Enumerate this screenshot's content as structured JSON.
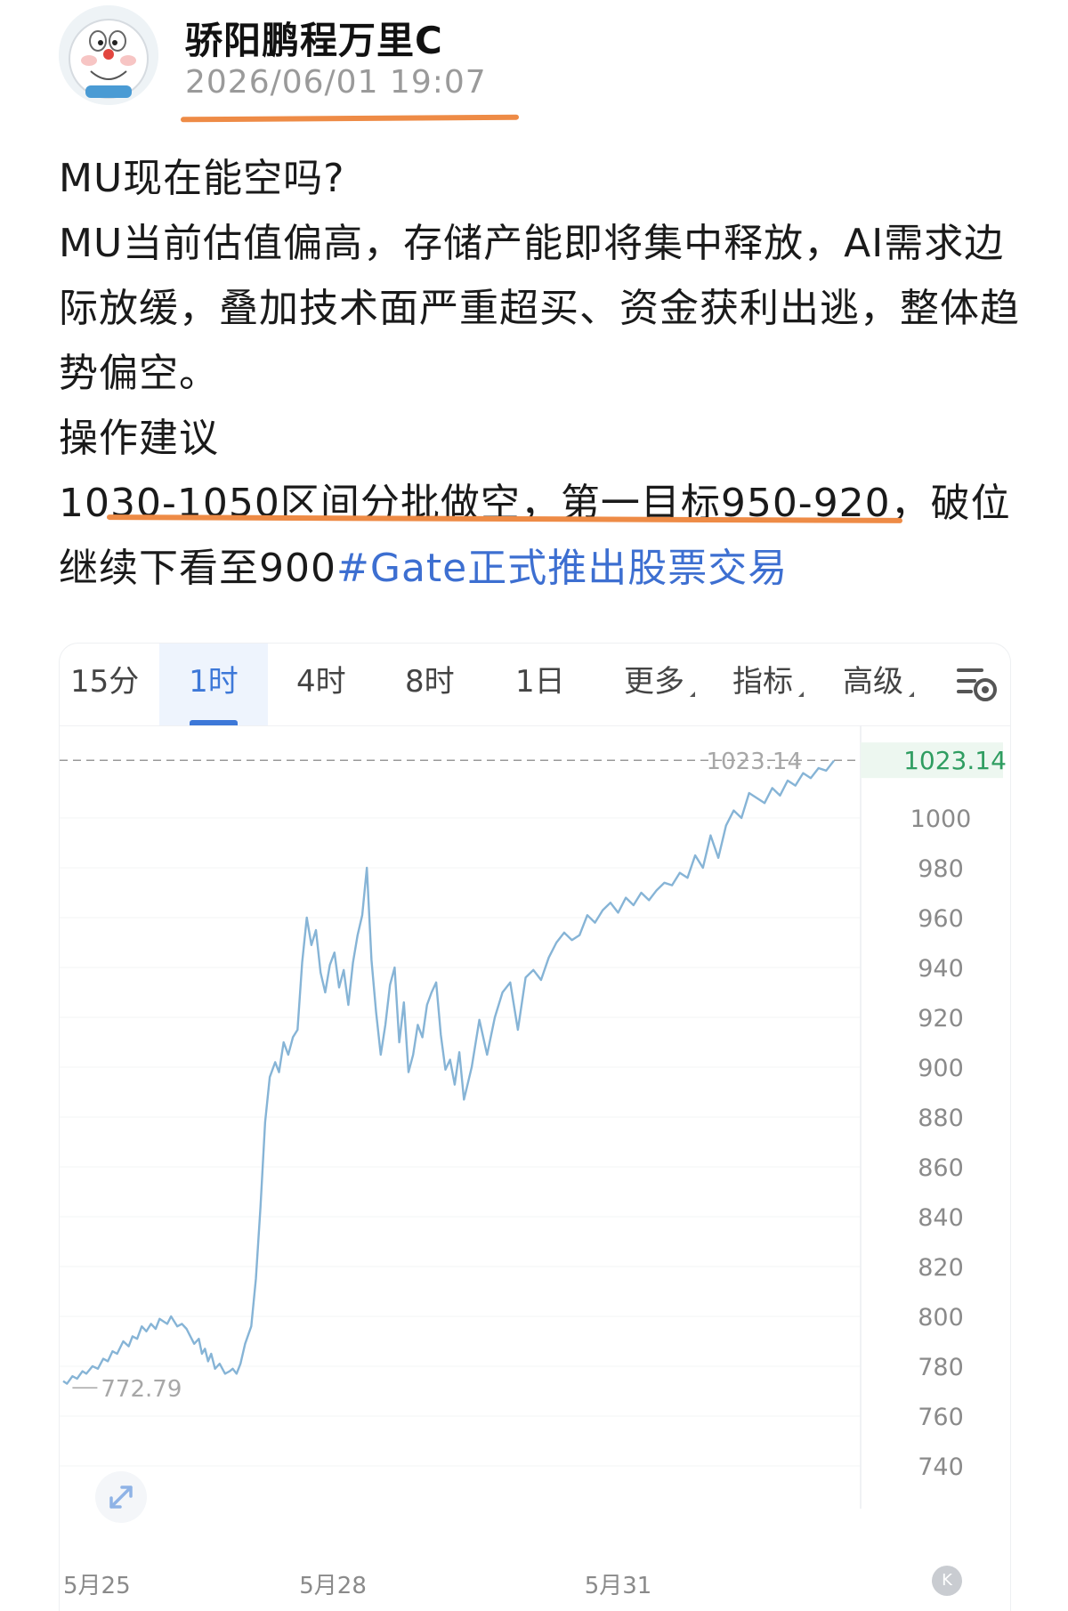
{
  "post": {
    "author": "骄阳鹏程万里C",
    "timestamp": "2026/06/01 19:07",
    "lines": [
      "MU现在能空吗?",
      "MU当前估值偏高，存储产能即将集中释放，AI需求边际放缓，叠加技术面严重超买、资金获利出逃，整体趋势偏空。",
      "操作建议",
      "1030-1050区间分批做空，第一目标950-920，破位继续下看至900"
    ],
    "hashtag": "#Gate正式推出股票交易"
  },
  "chart_toolbar": {
    "tabs": [
      {
        "label": "15分"
      },
      {
        "label": "1时"
      },
      {
        "label": "4时"
      },
      {
        "label": "8时"
      },
      {
        "label": "1日"
      },
      {
        "label": "更多"
      },
      {
        "label": "指标"
      },
      {
        "label": "高级"
      }
    ],
    "active_tab": "1时",
    "settings_icon": "chart-settings-icon"
  },
  "colors": {
    "accent": "#3d78d8",
    "line": "#86b4d6",
    "current_price": "#2f9d61",
    "highlight_underline": "#ee8b46",
    "hashtag": "#3d6fd1"
  },
  "chart_data": {
    "type": "line",
    "current_price": "1023.14",
    "high_label": "1023.14",
    "low_label": "772.79",
    "ylim": [
      730,
      1030
    ],
    "yticks": [
      1000,
      980,
      960,
      940,
      920,
      900,
      880,
      860,
      840,
      820,
      800,
      780,
      760,
      740
    ],
    "xticks": [
      "5月25",
      "5月28",
      "5月31"
    ],
    "x_range": [
      0,
      1.0
    ],
    "xtick_positions": [
      0.0,
      0.35,
      0.72
    ],
    "series": [
      {
        "x": [
          0.0,
          0.005,
          0.012,
          0.018,
          0.025,
          0.03,
          0.038,
          0.045,
          0.052,
          0.058,
          0.064,
          0.07,
          0.078,
          0.085,
          0.09,
          0.096,
          0.102,
          0.108,
          0.114,
          0.12,
          0.125,
          0.13,
          0.135,
          0.14,
          0.148,
          0.154,
          0.16,
          0.165,
          0.17,
          0.176,
          0.18,
          0.184,
          0.188,
          0.192,
          0.197,
          0.203,
          0.21,
          0.216,
          0.22,
          0.225,
          0.23,
          0.236,
          0.244,
          0.25,
          0.256,
          0.262,
          0.268,
          0.275,
          0.28,
          0.286,
          0.292,
          0.298,
          0.304,
          0.31,
          0.316,
          0.322,
          0.328,
          0.334,
          0.34,
          0.346,
          0.352,
          0.358,
          0.364,
          0.37,
          0.376,
          0.382,
          0.388,
          0.394,
          0.4,
          0.406,
          0.412,
          0.418,
          0.424,
          0.43,
          0.436,
          0.442,
          0.448,
          0.454,
          0.46,
          0.466,
          0.472,
          0.478,
          0.484,
          0.49,
          0.496,
          0.502,
          0.508,
          0.514,
          0.52,
          0.53,
          0.54,
          0.55,
          0.56,
          0.57,
          0.58,
          0.59,
          0.6,
          0.61,
          0.62,
          0.63,
          0.64,
          0.65,
          0.66,
          0.67,
          0.68,
          0.69,
          0.7,
          0.71,
          0.72,
          0.73,
          0.74,
          0.75,
          0.76,
          0.77,
          0.78,
          0.79,
          0.8,
          0.81,
          0.82,
          0.83,
          0.84,
          0.85,
          0.86,
          0.87,
          0.88,
          0.89,
          0.9,
          0.91,
          0.92,
          0.93,
          0.94,
          0.95,
          0.96,
          0.97,
          0.98,
          0.99,
          1.0
        ],
        "y": [
          774,
          773,
          776,
          775,
          778,
          777,
          780,
          779,
          783,
          782,
          786,
          785,
          790,
          788,
          792,
          791,
          796,
          794,
          797,
          795,
          799,
          798,
          797,
          800,
          796,
          797,
          795,
          792,
          789,
          791,
          785,
          787,
          782,
          785,
          779,
          781,
          777,
          778,
          779,
          777,
          781,
          789,
          796,
          815,
          844,
          878,
          896,
          902,
          898,
          910,
          905,
          912,
          915,
          942,
          960,
          949,
          955,
          938,
          930,
          941,
          946,
          932,
          939,
          925,
          942,
          953,
          961,
          980,
          943,
          922,
          905,
          917,
          933,
          940,
          910,
          926,
          898,
          905,
          917,
          912,
          925,
          930,
          934,
          913,
          899,
          903,
          893,
          906,
          887,
          900,
          919,
          905,
          920,
          930,
          934,
          915,
          936,
          939,
          935,
          944,
          950,
          954,
          951,
          953,
          961,
          958,
          963,
          966,
          962,
          968,
          965,
          970,
          967,
          971,
          974,
          973,
          978,
          976,
          985,
          980,
          993,
          984,
          997,
          1003,
          1000,
          1010,
          1008,
          1006,
          1012,
          1009,
          1015,
          1013,
          1018,
          1016,
          1020,
          1019,
          1023
        ]
      }
    ]
  }
}
